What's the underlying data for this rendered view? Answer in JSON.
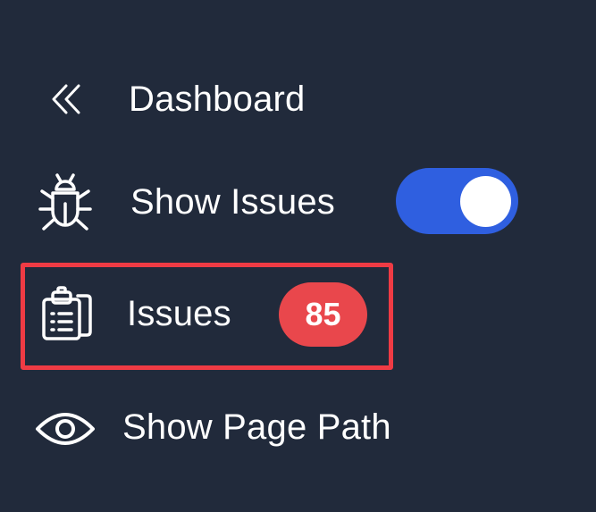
{
  "menu": {
    "collapse": {
      "label": "Dashboard",
      "icon": "double-chevron-left-icon"
    },
    "show_issues": {
      "label": "Show Issues",
      "icon": "bug-icon",
      "toggle_on": true,
      "toggle_color": "#2f5fe0"
    },
    "issues": {
      "label": "Issues",
      "icon": "clipboard-list-icon",
      "count": "85",
      "badge_color": "#e9474c",
      "highlighted": true,
      "highlight_color": "#ef3b44"
    },
    "page_path": {
      "label": "Show Page Path",
      "icon": "eye-icon"
    }
  },
  "colors": {
    "background": "#212a3b",
    "text": "#ffffff"
  }
}
